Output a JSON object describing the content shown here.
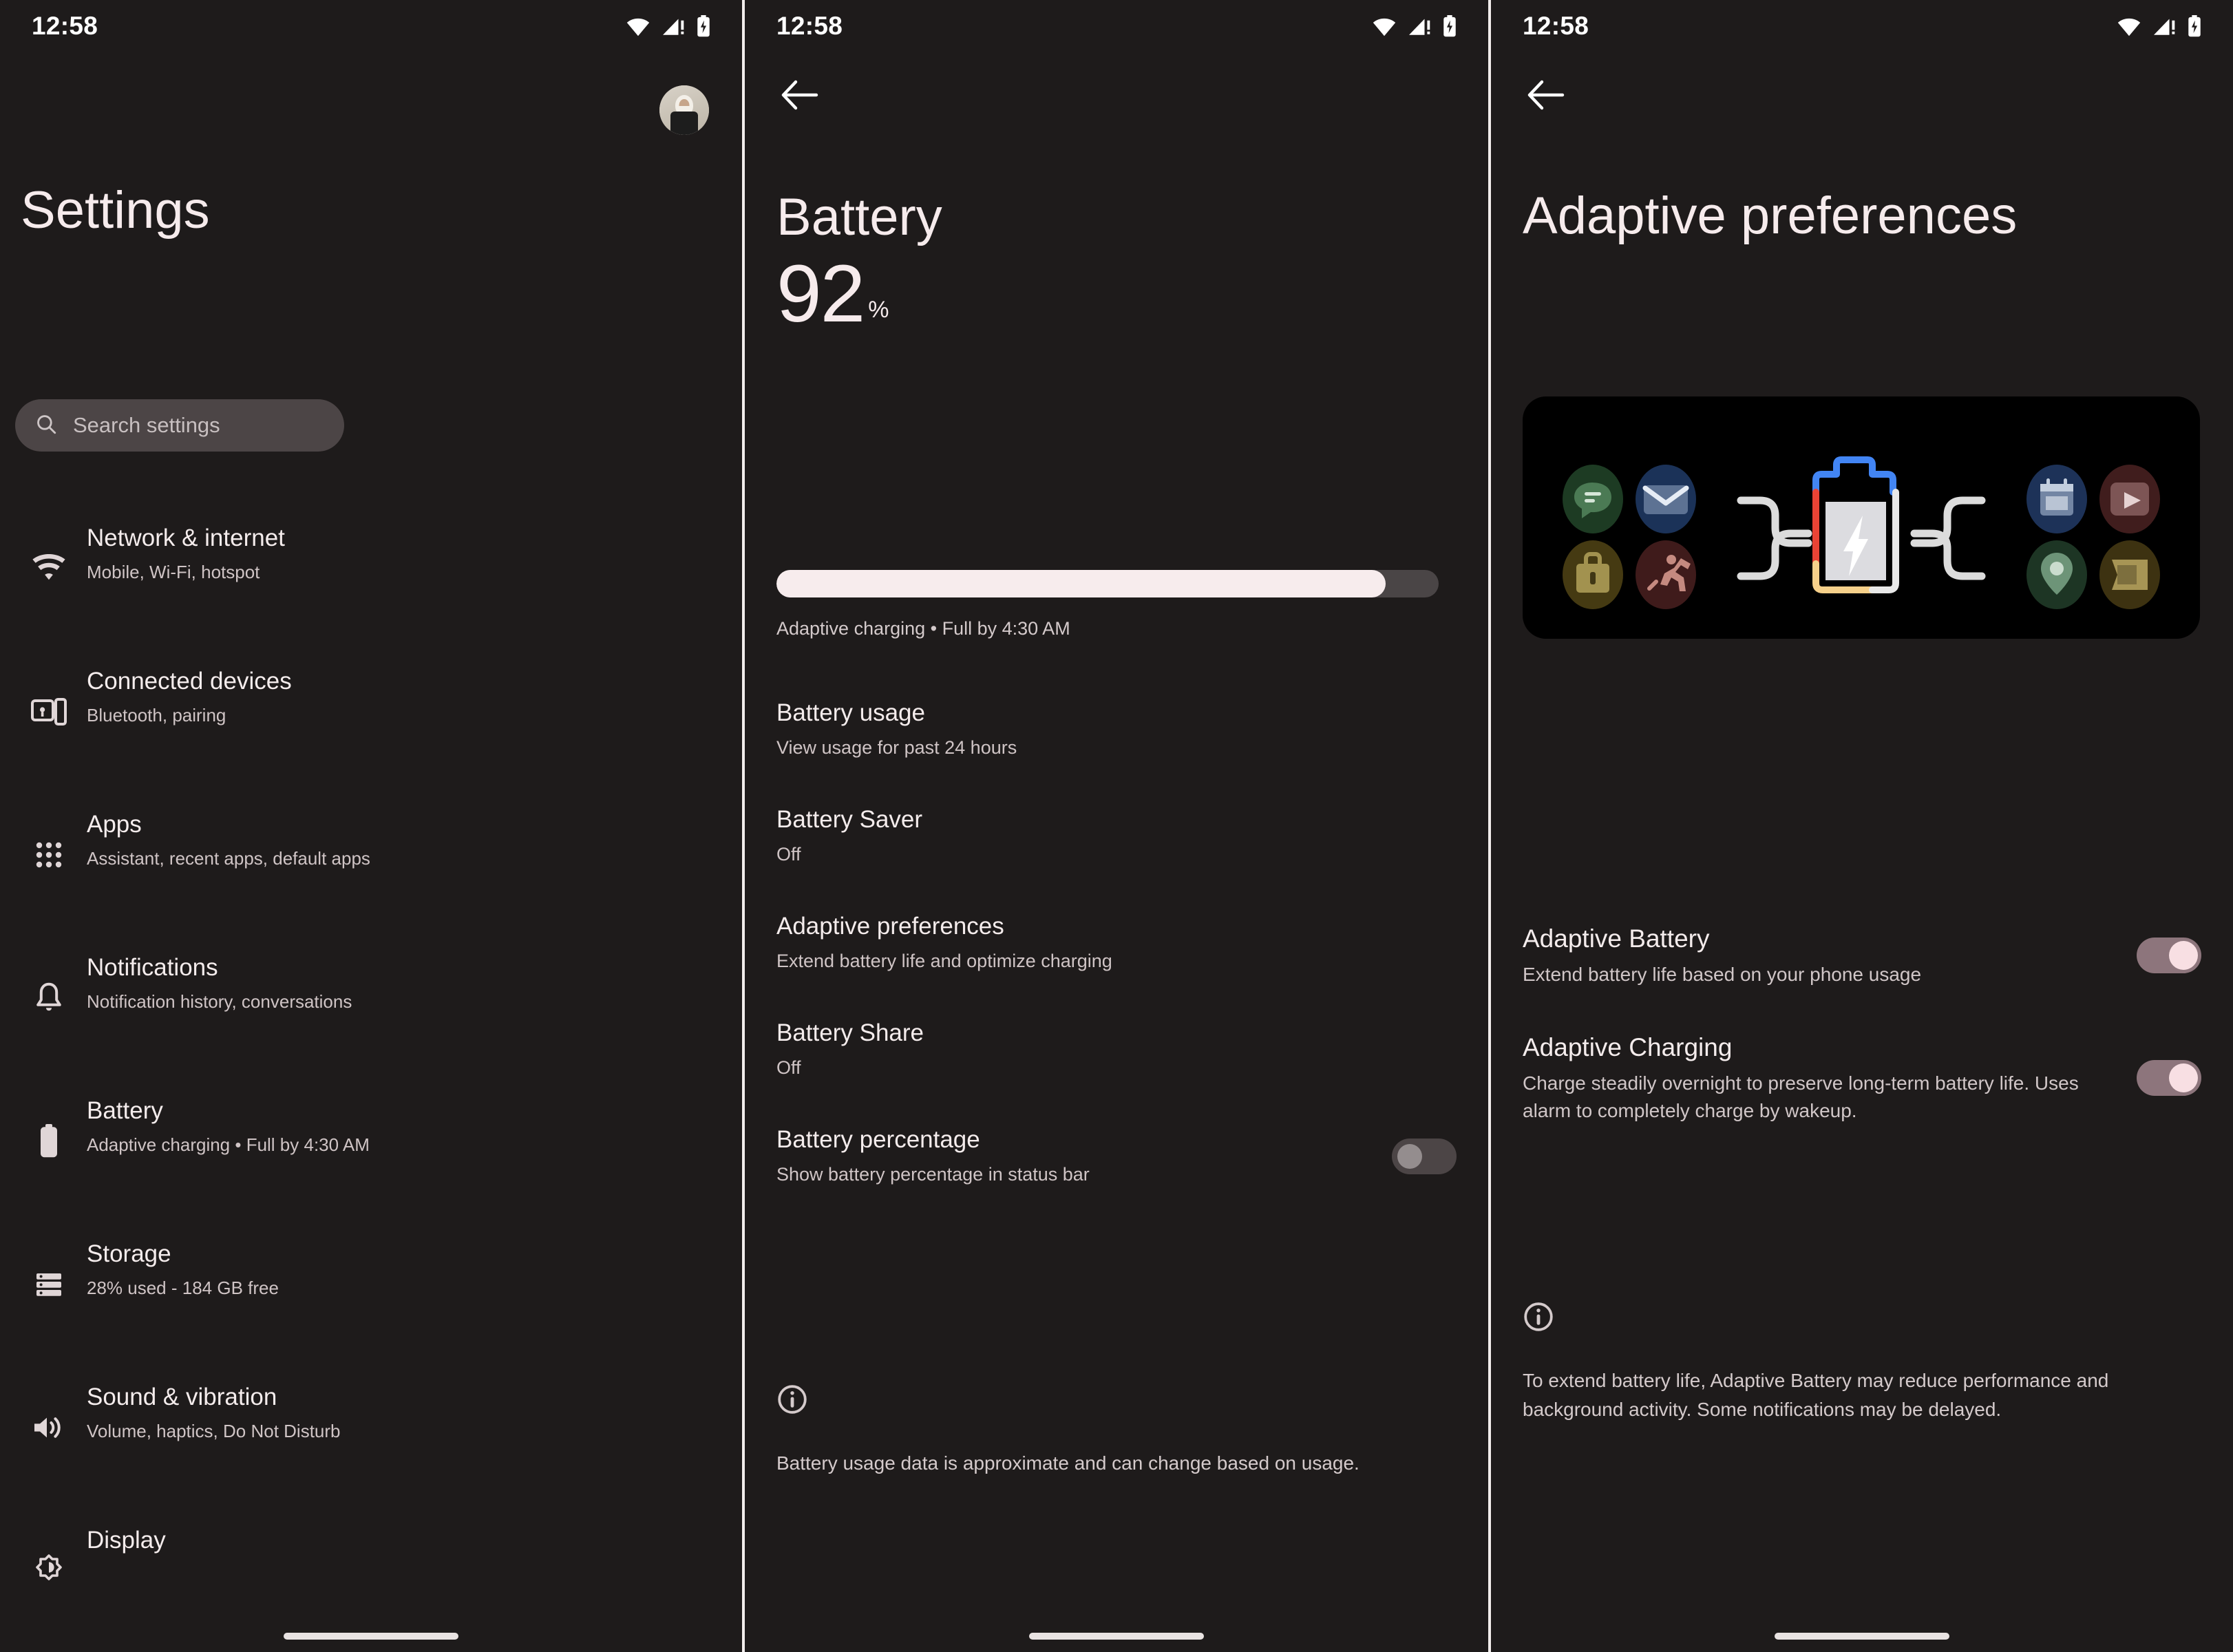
{
  "statusbar": {
    "time": "12:58",
    "icons": [
      "wifi-icon",
      "cellular-signal-icon",
      "battery-charging-icon"
    ]
  },
  "settings_screen": {
    "title": "Settings",
    "avatar_name": "account-avatar",
    "search": {
      "placeholder": "Search settings",
      "icon": "search-icon"
    },
    "items": [
      {
        "icon": "wifi-icon",
        "title": "Network & internet",
        "subtitle": "Mobile, Wi-Fi, hotspot"
      },
      {
        "icon": "connected-devices-icon",
        "title": "Connected devices",
        "subtitle": "Bluetooth, pairing"
      },
      {
        "icon": "apps-grid-icon",
        "title": "Apps",
        "subtitle": "Assistant, recent apps, default apps"
      },
      {
        "icon": "bell-icon",
        "title": "Notifications",
        "subtitle": "Notification history, conversations"
      },
      {
        "icon": "battery-icon",
        "title": "Battery",
        "subtitle": "Adaptive charging • Full by 4:30 AM"
      },
      {
        "icon": "storage-icon",
        "title": "Storage",
        "subtitle": "28% used - 184 GB free"
      },
      {
        "icon": "sound-icon",
        "title": "Sound & vibration",
        "subtitle": "Volume, haptics, Do Not Disturb"
      },
      {
        "icon": "display-brightness-icon",
        "title": "Display",
        "subtitle": ""
      }
    ]
  },
  "battery_screen": {
    "back_icon": "arrow-left-icon",
    "title": "Battery",
    "level_value": "92",
    "level_unit": "%",
    "level_percent": 92,
    "charge_status": "Adaptive charging • Full by 4:30 AM",
    "options": [
      {
        "title": "Battery usage",
        "subtitle": "View usage for past 24 hours"
      },
      {
        "title": "Battery Saver",
        "subtitle": "Off"
      },
      {
        "title": "Adaptive preferences",
        "subtitle": "Extend battery life and optimize charging"
      },
      {
        "title": "Battery Share",
        "subtitle": "Off"
      }
    ],
    "battery_percentage": {
      "title": "Battery percentage",
      "subtitle": "Show battery percentage in status bar",
      "state": "off"
    },
    "footer": {
      "icon": "info-icon",
      "text": "Battery usage data is approximate and can change based on usage."
    }
  },
  "adaptive_screen": {
    "back_icon": "arrow-left-icon",
    "title": "Adaptive preferences",
    "illustration": {
      "name": "adaptive-battery-illustration",
      "center_icon": "battery-bolt-icon",
      "app_icons": [
        "messages-icon",
        "gmail-icon",
        "calendar-icon",
        "play-video-icon",
        "briefcase-icon",
        "fitness-run-icon",
        "maps-pin-icon",
        "ticket-icon"
      ],
      "app_icon_colors": [
        "#1d3b23",
        "#1b3258",
        "#1d3258",
        "#401d1d",
        "#453a12",
        "#3f1b1b",
        "#1d3524",
        "#3d3211"
      ]
    },
    "preferences": [
      {
        "title": "Adaptive Battery",
        "subtitle": "Extend battery life based on your phone usage",
        "state": "on"
      },
      {
        "title": "Adaptive Charging",
        "subtitle": "Charge steadily overnight to preserve long-term battery life. Uses alarm to completely charge by wakeup.",
        "state": "on"
      }
    ],
    "footer": {
      "icon": "info-icon",
      "text": "To extend battery life, Adaptive Battery may reduce performance and background activity. Some notifications may be delayed."
    }
  },
  "colors": {
    "background": "#1e1b1b",
    "illustration_background": "#000000",
    "accent_light": "#f6ebec",
    "toggle_on_track": "#8d757c",
    "toggle_on_thumb": "#f8dfe3",
    "toggle_off_track": "#4c4546",
    "toggle_off_thumb": "#948d8e",
    "search_background": "#4c4546",
    "primary_text": "#f4ecec",
    "secondary_text": "#cfc4c5",
    "progress_fill": "#f7eced",
    "progress_track": "#4a4546"
  }
}
